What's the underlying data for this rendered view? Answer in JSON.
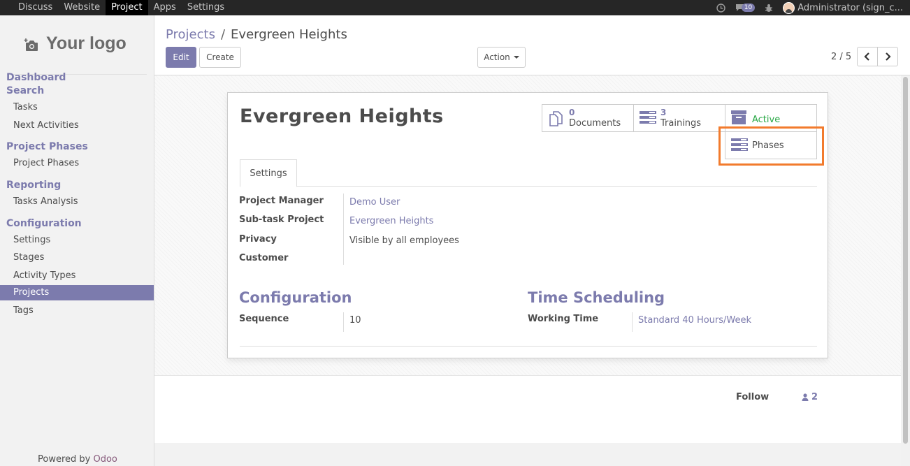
{
  "topbar": {
    "menu": [
      "Discuss",
      "Website",
      "Project",
      "Apps",
      "Settings"
    ],
    "active_menu": "Project",
    "message_count": "10",
    "user": "Administrator (sign_c..."
  },
  "sidebar": {
    "logo": "Your logo",
    "sections": [
      {
        "title": "Dashboard Search",
        "items": [
          "Tasks",
          "Next Activities"
        ]
      },
      {
        "title": "Project Phases",
        "items": [
          "Project Phases"
        ]
      },
      {
        "title": "Reporting",
        "items": [
          "Tasks Analysis"
        ]
      },
      {
        "title": "Configuration",
        "items": [
          "Settings",
          "Stages",
          "Activity Types",
          "Projects",
          "Tags"
        ]
      }
    ],
    "active_item": "Projects",
    "powered_prefix": "Powered by ",
    "powered_brand": "Odoo"
  },
  "control_panel": {
    "breadcrumb_parent": "Projects",
    "breadcrumb_sep": "/",
    "breadcrumb_current": "Evergreen Heights",
    "edit_label": "Edit",
    "create_label": "Create",
    "action_label": "Action",
    "pager": "2 / 5"
  },
  "record": {
    "title": "Evergreen Heights",
    "smart_buttons": {
      "documents": {
        "count": "0",
        "label": "Documents"
      },
      "trainings": {
        "count": "3",
        "label": "Trainings"
      },
      "active": {
        "label": "Active"
      },
      "phases": {
        "label": "Phases"
      }
    },
    "tab": "Settings",
    "fields": [
      {
        "label": "Project Manager",
        "value": "Demo User"
      },
      {
        "label": "Sub-task Project",
        "value": "Evergreen Heights"
      },
      {
        "label": "Privacy",
        "value": "Visible by all employees"
      },
      {
        "label": "Customer",
        "value": ""
      }
    ],
    "configuration": {
      "title": "Configuration",
      "label": "Sequence",
      "value": "10"
    },
    "time_scheduling": {
      "title": "Time Scheduling",
      "label": "Working Time",
      "value": "Standard 40 Hours/Week"
    }
  },
  "chatter": {
    "follow_label": "Follow",
    "followers_count": "2"
  },
  "colors": {
    "brand": "#7c7bad",
    "active_green": "#28a745",
    "highlight": "#f27b2d"
  }
}
